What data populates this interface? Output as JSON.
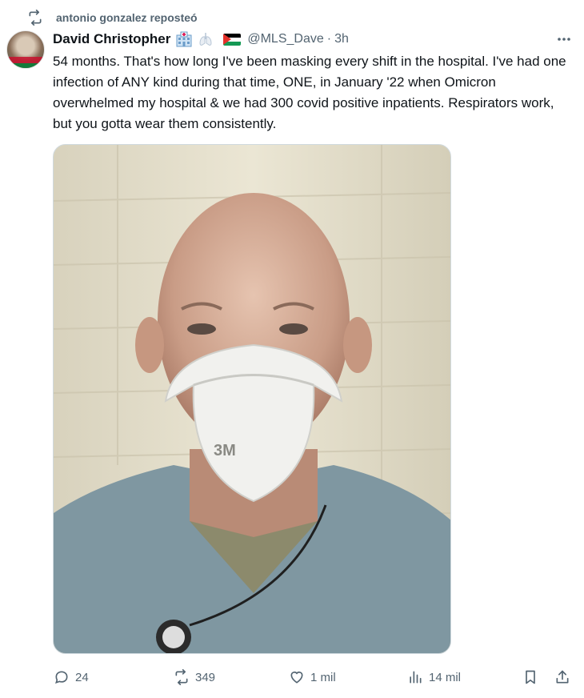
{
  "repost": {
    "text": "antonio gonzalez reposteó",
    "icon": "repost-icon"
  },
  "author": {
    "name": "David Christopher",
    "handle": "@MLS_Dave",
    "separator": "·",
    "time": "3h",
    "emoji": [
      "hospital-icon",
      "lungs-icon",
      "palestine-flag-icon"
    ]
  },
  "tweet": {
    "text": "54 months. That's how long I've been masking every shift in the hospital. I've had one infection of ANY kind during that time, ONE, in January '22 when Omicron overwhelmed my hospital & we had 300 covid positive inpatients. Respirators work, but you gotta wear them consistently."
  },
  "media": {
    "mask_brand": "3M"
  },
  "actions": {
    "reply_count": "24",
    "repost_count": "349",
    "like_count": "1 mil",
    "views_count": "14 mil"
  },
  "colors": {
    "muted": "#536471",
    "text": "#0f1419",
    "border": "#cfd9de"
  }
}
